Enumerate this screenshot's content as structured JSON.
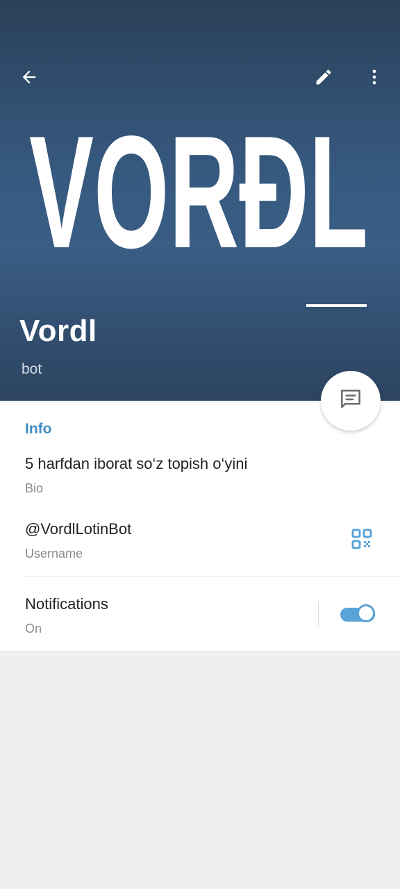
{
  "header": {
    "logo_text": "VORÐL",
    "title": "Vordl",
    "subtitle": "bot",
    "icons": {
      "back": "arrow-back-icon",
      "edit": "pencil-icon",
      "more": "more-vertical-icon",
      "message": "message-icon"
    },
    "colors": {
      "header_top": "#2a4058",
      "header_mid": "#3a5d84",
      "accent": "#3f8cc4",
      "toggle": "#5aa3d8"
    }
  },
  "info": {
    "section_title": "Info",
    "bio": {
      "value": "5 harfdan iborat so‘z topish o‘yini",
      "label": "Bio"
    },
    "username": {
      "value": "@VordlLotinBot",
      "label": "Username",
      "icon": "qr-code-icon"
    },
    "notifications": {
      "value": "Notifications",
      "label": "On",
      "enabled": true
    }
  }
}
